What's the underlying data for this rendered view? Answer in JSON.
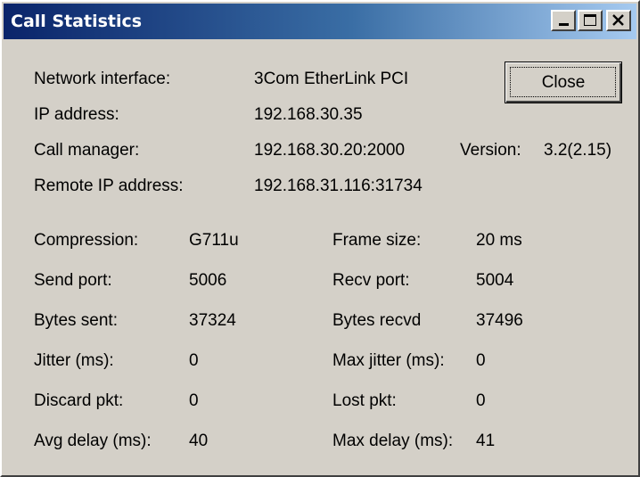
{
  "window": {
    "title": "Call Statistics",
    "titlebar_gradient": [
      "#0a246a",
      "#3a6ea5",
      "#a6caf0"
    ],
    "face_color": "#d4d0c8"
  },
  "titlebar_buttons": {
    "minimize_icon": "minimize-icon",
    "maximize_icon": "maximize-icon",
    "close_icon": "close-icon"
  },
  "info": {
    "network_interface_label": "Network interface:",
    "network_interface_value": "3Com EtherLink PCI",
    "ip_address_label": "IP address:",
    "ip_address_value": "192.168.30.35",
    "call_manager_label": "Call manager:",
    "call_manager_value": "192.168.30.20:2000",
    "version_label": "Version:",
    "version_value": "3.2(2.15)",
    "remote_ip_label": "Remote IP address:",
    "remote_ip_value": "192.168.31.116:31734"
  },
  "close_button": {
    "label": "Close"
  },
  "stats": {
    "compression_label": "Compression:",
    "compression_value": "G711u",
    "frame_size_label": "Frame size:",
    "frame_size_value": "20 ms",
    "send_port_label": "Send port:",
    "send_port_value": "5006",
    "recv_port_label": "Recv port:",
    "recv_port_value": "5004",
    "bytes_sent_label": "Bytes sent:",
    "bytes_sent_value": "37324",
    "bytes_recvd_label": "Bytes recvd",
    "bytes_recvd_value": "37496",
    "jitter_label": "Jitter (ms):",
    "jitter_value": "0",
    "max_jitter_label": "Max jitter (ms):",
    "max_jitter_value": "0",
    "discard_label": "Discard pkt:",
    "discard_value": "0",
    "lost_label": "Lost pkt:",
    "lost_value": "0",
    "avg_delay_label": "Avg delay (ms):",
    "avg_delay_value": "40",
    "max_delay_label": "Max delay (ms):",
    "max_delay_value": "41"
  }
}
